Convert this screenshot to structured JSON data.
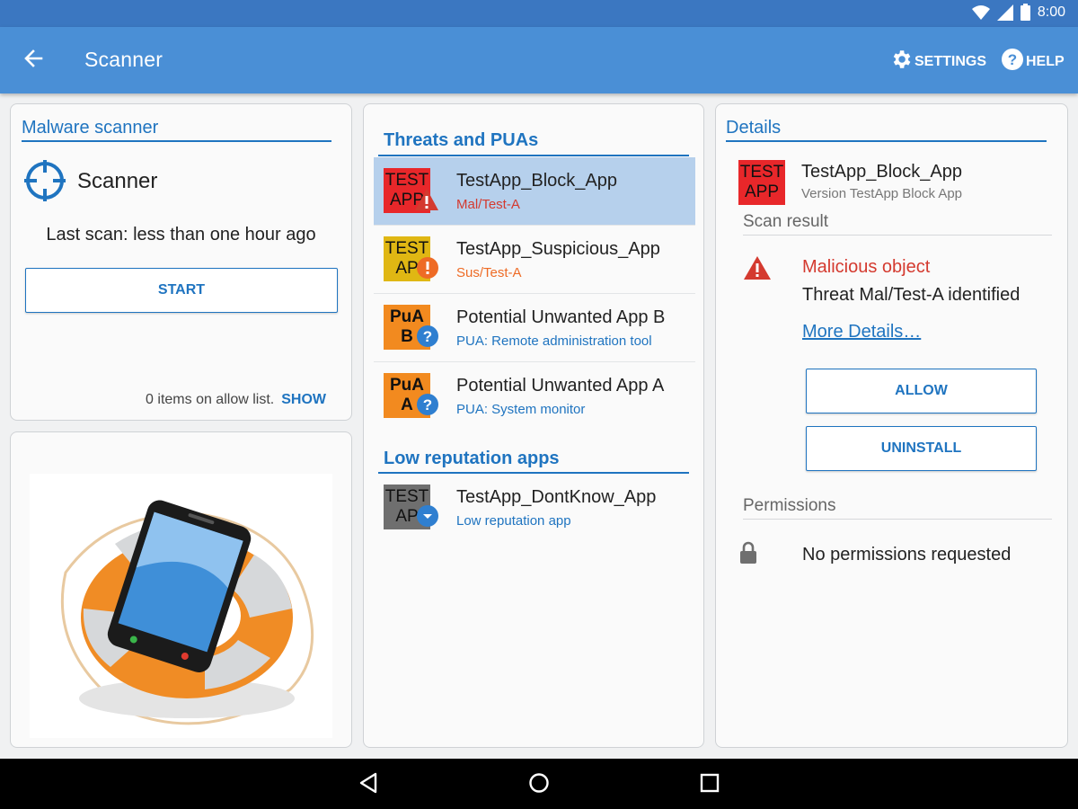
{
  "status_bar": {
    "time": "8:00"
  },
  "app_bar": {
    "title": "Scanner",
    "settings_label": "SETTINGS",
    "help_label": "HELP",
    "color": "#4a8fd6"
  },
  "scanner_panel": {
    "heading": "Malware scanner",
    "scanner_name": "Scanner",
    "last_scan": "Last scan: less than one hour ago",
    "start_label": "START",
    "allow_list_text": "0 items on allow list.",
    "show_label": "SHOW"
  },
  "threats_panel": {
    "heading": "Threats and PUAs",
    "items": [
      {
        "icon_text": "TEST APP",
        "icon_color": "#e8272a",
        "badge": "warning-icon",
        "title": "TestApp_Block_App",
        "subtitle": "Mal/Test-A",
        "subtitle_color": "#d43a2f",
        "selected": true
      },
      {
        "icon_text": "TEST AP",
        "icon_color": "#e0b713",
        "badge": "exclamation-icon",
        "title": "TestApp_Suspicious_App",
        "subtitle": "Sus/Test-A",
        "subtitle_color": "#ee6b25",
        "selected": false
      },
      {
        "icon_text": "PuA B",
        "icon_color": "#f28a1f",
        "badge": "question-icon",
        "title": "Potential Unwanted App B",
        "subtitle": "PUA: Remote administration tool",
        "subtitle_color": "#1f74c0",
        "selected": false
      },
      {
        "icon_text": "PuA A",
        "icon_color": "#f28a1f",
        "badge": "question-icon",
        "title": "Potential Unwanted App A",
        "subtitle": "PUA: System monitor",
        "subtitle_color": "#1f74c0",
        "selected": false
      }
    ],
    "low_rep_heading": "Low reputation apps",
    "low_rep_items": [
      {
        "icon_text": "TEST AP",
        "icon_color": "#6f6f6f",
        "badge": "chevron-down-icon",
        "title": "TestApp_DontKnow_App",
        "subtitle": "Low reputation app",
        "subtitle_color": "#1f74c0"
      }
    ]
  },
  "details_panel": {
    "heading": "Details",
    "app_icon_text": "TEST APP",
    "app_title": "TestApp_Block_App",
    "app_version": "Version TestApp Block App",
    "scan_result_label": "Scan result",
    "result_title": "Malicious object",
    "result_desc": "Threat Mal/Test-A identified",
    "more_details": "More Details…",
    "allow_label": "ALLOW",
    "uninstall_label": "UNINSTALL",
    "permissions_label": "Permissions",
    "permissions_text": "No permissions requested"
  }
}
